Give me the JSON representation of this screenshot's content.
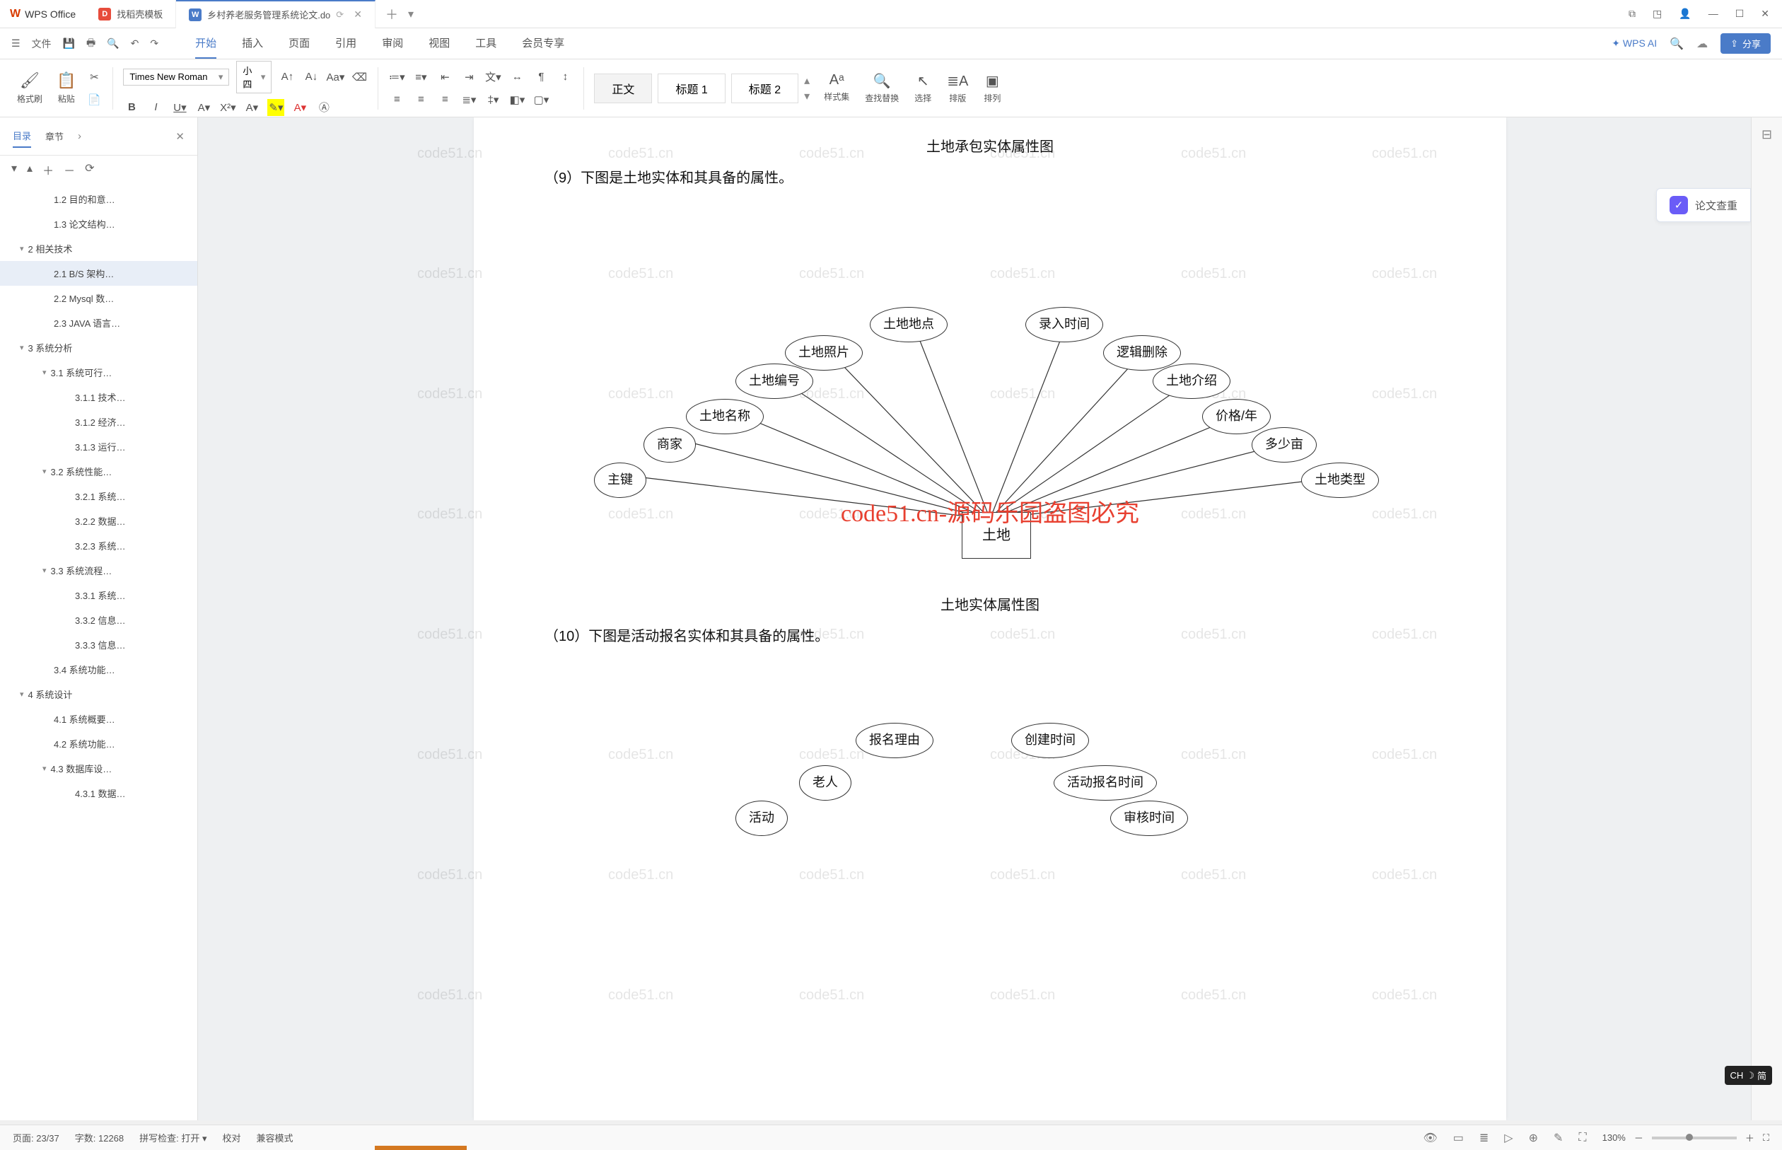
{
  "app": {
    "name": "WPS Office"
  },
  "tabs": {
    "template": "找稻壳模板",
    "doc": "乡村养老服务管理系统论文.do"
  },
  "menu": {
    "file": "文件",
    "items": [
      "开始",
      "插入",
      "页面",
      "引用",
      "审阅",
      "视图",
      "工具",
      "会员专享"
    ],
    "wpsai": "WPS AI",
    "share": "分享"
  },
  "ribbon": {
    "format_painter": "格式刷",
    "paste": "粘贴",
    "font_name": "Times New Roman",
    "font_size": "小四",
    "style_body": "正文",
    "style_h1": "标题 1",
    "style_h2": "标题 2",
    "styles": "样式集",
    "findrep": "查找替换",
    "select": "选择",
    "arrange": "排版",
    "order": "排列"
  },
  "outline": {
    "tab1": "目录",
    "tab2": "章节",
    "items": [
      {
        "t": "1.2 目的和意…",
        "lvl": 2
      },
      {
        "t": "1.3 论文结构…",
        "lvl": 2
      },
      {
        "t": "2  相关技术",
        "lvl": 1,
        "caret": true
      },
      {
        "t": "2.1 B/S 架构…",
        "lvl": 2,
        "active": true
      },
      {
        "t": "2.2 Mysql 数…",
        "lvl": 2
      },
      {
        "t": "2.3 JAVA 语言…",
        "lvl": 2
      },
      {
        "t": "3  系统分析",
        "lvl": 1,
        "caret": true
      },
      {
        "t": "3.1 系统可行…",
        "lvl": 2,
        "caret": true
      },
      {
        "t": "3.1.1 技术…",
        "lvl": 3
      },
      {
        "t": "3.1.2 经济…",
        "lvl": 3
      },
      {
        "t": "3.1.3 运行…",
        "lvl": 3
      },
      {
        "t": "3.2 系统性能…",
        "lvl": 2,
        "caret": true
      },
      {
        "t": "3.2.1  系统…",
        "lvl": 3
      },
      {
        "t": "3.2.2 数据…",
        "lvl": 3
      },
      {
        "t": "3.2.3 系统…",
        "lvl": 3
      },
      {
        "t": "3.3 系统流程…",
        "lvl": 2,
        "caret": true
      },
      {
        "t": "3.3.1 系统…",
        "lvl": 3
      },
      {
        "t": "3.3.2 信息…",
        "lvl": 3
      },
      {
        "t": "3.3.3 信息…",
        "lvl": 3
      },
      {
        "t": "3.4 系统功能…",
        "lvl": 2
      },
      {
        "t": "4  系统设计",
        "lvl": 1,
        "caret": true
      },
      {
        "t": "4.1 系统概要…",
        "lvl": 2
      },
      {
        "t": "4.2 系统功能…",
        "lvl": 2
      },
      {
        "t": "4.3 数据库设…",
        "lvl": 2,
        "caret": true
      },
      {
        "t": "4.3.1 数据…",
        "lvl": 3
      }
    ]
  },
  "doc": {
    "caption1": "土地承包实体属性图",
    "line9": "（9）下图是土地实体和其具备的属性。",
    "caption2": "土地实体属性图",
    "line10": "（10）下图是活动报名实体和其具备的属性。",
    "er1": {
      "center": "土地",
      "nodes": [
        "主键",
        "商家",
        "土地名称",
        "土地编号",
        "土地照片",
        "土地地点",
        "录入时间",
        "逻辑删除",
        "土地介绍",
        "价格/年",
        "多少亩",
        "土地类型"
      ]
    },
    "er2": {
      "nodes": [
        "活动",
        "老人",
        "报名理由",
        "创建时间",
        "活动报名时间",
        "审核时间"
      ]
    },
    "watermark": "code51.cn",
    "wm_red": "code51.cn-源码乐园盗图必究"
  },
  "floating": {
    "plagiarism": "论文查重"
  },
  "ime": {
    "lang": "CH",
    "mode": "简"
  },
  "status": {
    "page": "页面: 23/37",
    "words": "字数: 12268",
    "spell": "拼写检查: 打开",
    "proof": "校对",
    "compat": "兼容模式",
    "zoom": "130%"
  }
}
